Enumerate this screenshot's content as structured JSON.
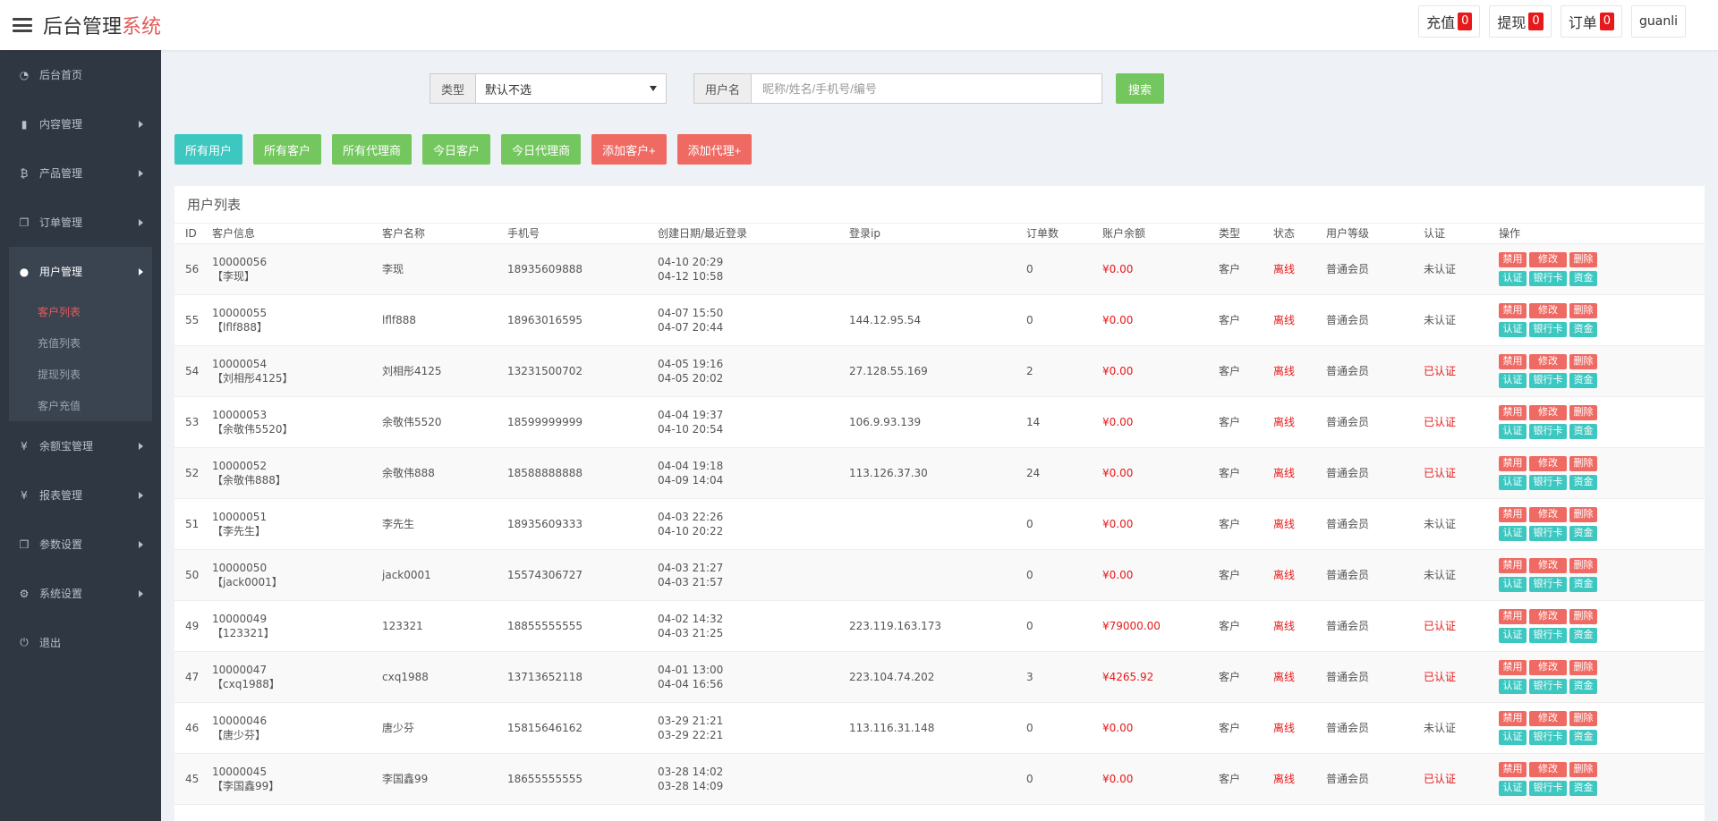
{
  "header": {
    "brand_main": "后台管理",
    "brand_accent": "系统",
    "buttons": [
      {
        "label": "充值",
        "count": "0"
      },
      {
        "label": "提现",
        "count": "0"
      },
      {
        "label": "订单",
        "count": "0"
      }
    ],
    "user": "guanli"
  },
  "sidebar": {
    "items": [
      {
        "label": "后台首页",
        "icon": "dashboard-icon"
      },
      {
        "label": "内容管理",
        "icon": "book-icon"
      },
      {
        "label": "产品管理",
        "icon": "bitcoin-icon"
      },
      {
        "label": "订单管理",
        "icon": "copy-icon"
      }
    ],
    "active_group": {
      "label": "用户管理",
      "icon": "user-icon",
      "sub_items": [
        "客户列表",
        "充值列表",
        "提现列表",
        "客户充值"
      ],
      "active_sub": "客户列表"
    },
    "items_after": [
      {
        "label": "余额宝管理",
        "icon": "yen-icon"
      },
      {
        "label": "报表管理",
        "icon": "yen-icon"
      },
      {
        "label": "参数设置",
        "icon": "copy-icon"
      },
      {
        "label": "系统设置",
        "icon": "cogs-icon"
      },
      {
        "label": "退出",
        "icon": "logout-icon"
      }
    ]
  },
  "filter": {
    "type_label": "类型",
    "type_value": "默认不选",
    "user_label": "用户名",
    "user_placeholder": "昵称/姓名/手机号/编号",
    "search_label": "搜索"
  },
  "actions": [
    "所有用户",
    "所有客户",
    "所有代理商",
    "今日客户",
    "今日代理商",
    "添加客户+",
    "添加代理+"
  ],
  "table": {
    "title": "用户列表",
    "columns": [
      "ID",
      "客户信息",
      "客户名称",
      "手机号",
      "创建日期/最近登录",
      "登录ip",
      "订单数",
      "账户余额",
      "类型",
      "状态",
      "用户等级",
      "认证",
      "操作"
    ],
    "ops_row1": [
      "禁用",
      "修改",
      "删除"
    ],
    "ops_row2": [
      "认证",
      "银行卡",
      "资金"
    ],
    "rows": [
      {
        "id": "56",
        "code": "10000056",
        "alias": "【李现】",
        "name": "李现",
        "phone": "18935609888",
        "created": "04-10 20:29",
        "last": "04-12 10:58",
        "ip": "",
        "orders": "0",
        "balance": "¥0.00",
        "type": "客户",
        "status": "离线",
        "level": "普通会员",
        "cert": "未认证"
      },
      {
        "id": "55",
        "code": "10000055",
        "alias": "【lflf888】",
        "name": "lflf888",
        "phone": "18963016595",
        "created": "04-07 15:50",
        "last": "04-07 20:44",
        "ip": "144.12.95.54",
        "orders": "0",
        "balance": "¥0.00",
        "type": "客户",
        "status": "离线",
        "level": "普通会员",
        "cert": "未认证"
      },
      {
        "id": "54",
        "code": "10000054",
        "alias": "【刘相彤4125】",
        "name": "刘相彤4125",
        "phone": "13231500702",
        "created": "04-05 19:16",
        "last": "04-05 20:02",
        "ip": "27.128.55.169",
        "orders": "2",
        "balance": "¥0.00",
        "type": "客户",
        "status": "离线",
        "level": "普通会员",
        "cert": "已认证"
      },
      {
        "id": "53",
        "code": "10000053",
        "alias": "【余敬伟5520】",
        "name": "余敬伟5520",
        "phone": "18599999999",
        "created": "04-04 19:37",
        "last": "04-10 20:54",
        "ip": "106.9.93.139",
        "orders": "14",
        "balance": "¥0.00",
        "type": "客户",
        "status": "离线",
        "level": "普通会员",
        "cert": "已认证"
      },
      {
        "id": "52",
        "code": "10000052",
        "alias": "【余敬伟888】",
        "name": "余敬伟888",
        "phone": "18588888888",
        "created": "04-04 19:18",
        "last": "04-09 14:04",
        "ip": "113.126.37.30",
        "orders": "24",
        "balance": "¥0.00",
        "type": "客户",
        "status": "离线",
        "level": "普通会员",
        "cert": "已认证"
      },
      {
        "id": "51",
        "code": "10000051",
        "alias": "【李先生】",
        "name": "李先生",
        "phone": "18935609333",
        "created": "04-03 22:26",
        "last": "04-10 20:22",
        "ip": "",
        "orders": "0",
        "balance": "¥0.00",
        "type": "客户",
        "status": "离线",
        "level": "普通会员",
        "cert": "未认证"
      },
      {
        "id": "50",
        "code": "10000050",
        "alias": "【jack0001】",
        "name": "jack0001",
        "phone": "15574306727",
        "created": "04-03 21:27",
        "last": "04-03 21:57",
        "ip": "",
        "orders": "0",
        "balance": "¥0.00",
        "type": "客户",
        "status": "离线",
        "level": "普通会员",
        "cert": "未认证"
      },
      {
        "id": "49",
        "code": "10000049",
        "alias": "【123321】",
        "name": "123321",
        "phone": "18855555555",
        "created": "04-02 14:32",
        "last": "04-03 21:25",
        "ip": "223.119.163.173",
        "orders": "0",
        "balance": "¥79000.00",
        "type": "客户",
        "status": "离线",
        "level": "普通会员",
        "cert": "已认证"
      },
      {
        "id": "47",
        "code": "10000047",
        "alias": "【cxq1988】",
        "name": "cxq1988",
        "phone": "13713652118",
        "created": "04-01 13:00",
        "last": "04-04 16:56",
        "ip": "223.104.74.202",
        "orders": "3",
        "balance": "¥4265.92",
        "type": "客户",
        "status": "离线",
        "level": "普通会员",
        "cert": "已认证"
      },
      {
        "id": "46",
        "code": "10000046",
        "alias": "【唐少芬】",
        "name": "唐少芬",
        "phone": "15815646162",
        "created": "03-29 21:21",
        "last": "03-29 22:21",
        "ip": "113.116.31.148",
        "orders": "0",
        "balance": "¥0.00",
        "type": "客户",
        "status": "离线",
        "level": "普通会员",
        "cert": "未认证"
      },
      {
        "id": "45",
        "code": "10000045",
        "alias": "【李国鑫99】",
        "name": "李国鑫99",
        "phone": "18655555555",
        "created": "03-28 14:02",
        "last": "03-28 14:09",
        "ip": "",
        "orders": "0",
        "balance": "¥0.00",
        "type": "客户",
        "status": "离线",
        "level": "普通会员",
        "cert": "已认证"
      }
    ]
  }
}
